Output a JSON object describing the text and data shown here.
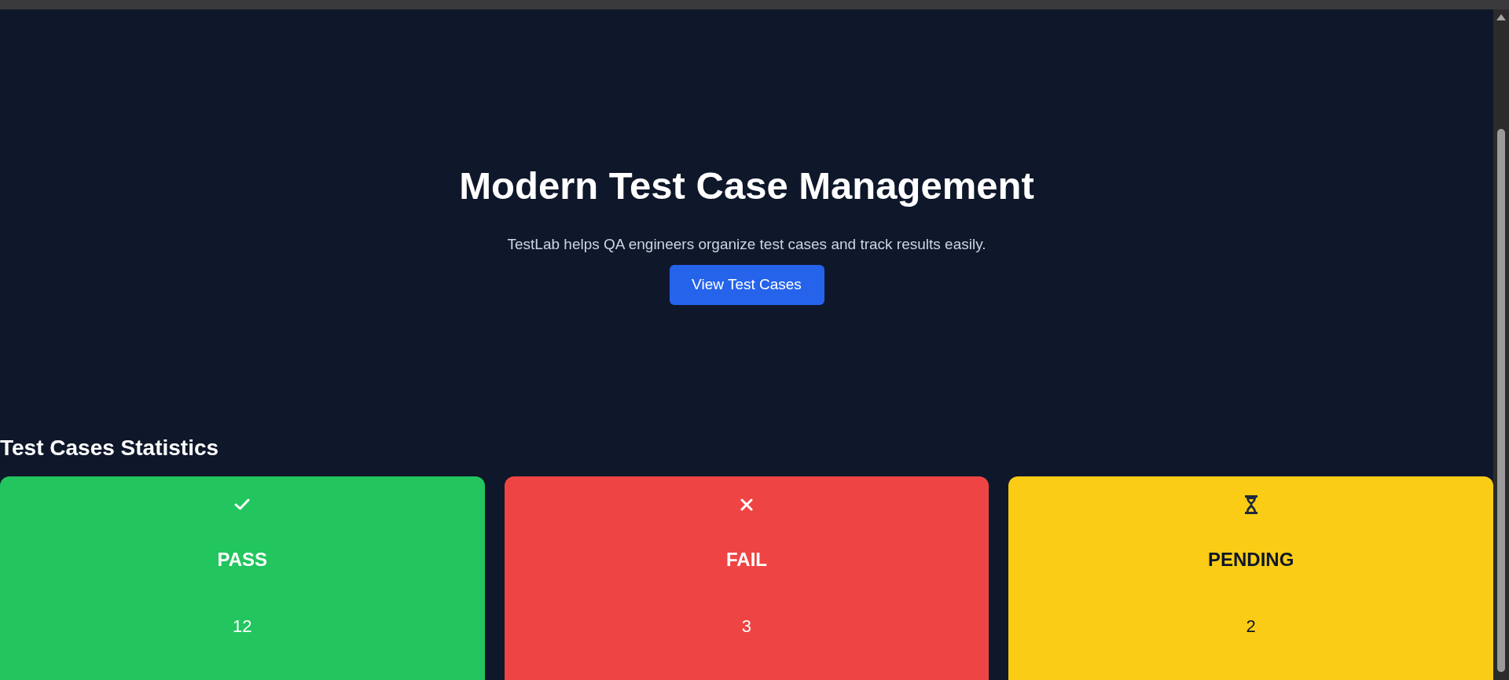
{
  "hero": {
    "title": "Modern Test Case Management",
    "subtitle": "TestLab helps QA engineers organize test cases and track results easily.",
    "button": "View Test Cases"
  },
  "statistics": {
    "title": "Test Cases Statistics",
    "cards": [
      {
        "kind": "pass",
        "label": "PASS",
        "count": "12"
      },
      {
        "kind": "fail",
        "label": "FAIL",
        "count": "3"
      },
      {
        "kind": "pending",
        "label": "PENDING",
        "count": "2"
      }
    ]
  }
}
